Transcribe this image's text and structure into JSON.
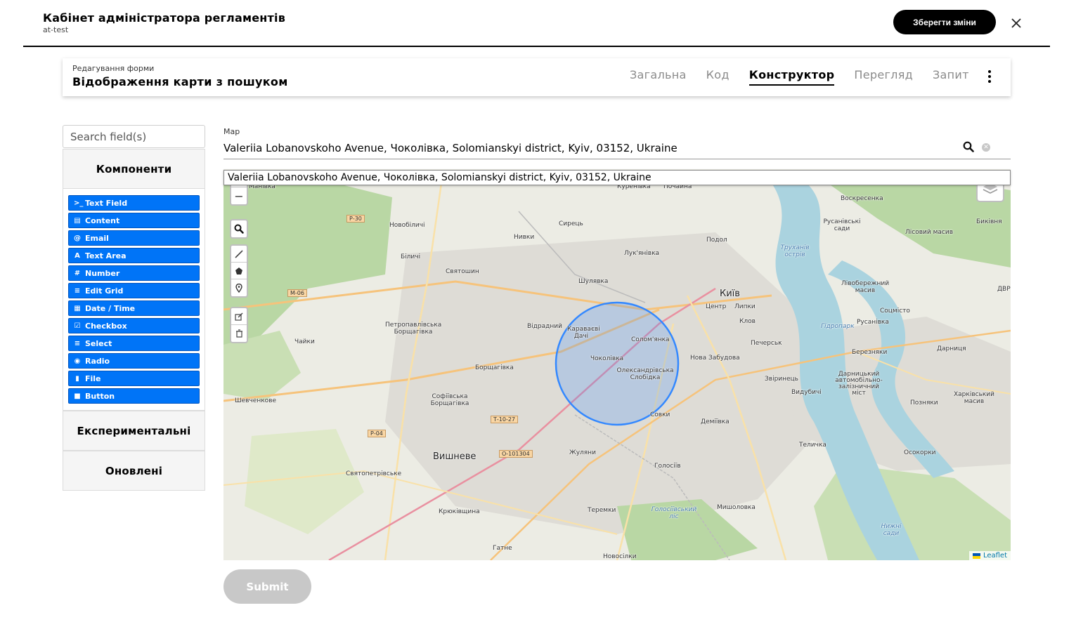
{
  "header": {
    "title": "Кабінет адміністратора регламентів",
    "subtitle": "at-test",
    "save_label": "Зберегти зміни"
  },
  "form": {
    "caption": "Редагування форми",
    "name": "Відображення карти з пошуком",
    "tabs": [
      {
        "label": "Загальна",
        "active": false
      },
      {
        "label": "Код",
        "active": false
      },
      {
        "label": "Конструктор",
        "active": true
      },
      {
        "label": "Перегляд",
        "active": false
      },
      {
        "label": "Запит",
        "active": false
      }
    ]
  },
  "sidebar": {
    "search_placeholder": "Search field(s)",
    "groups": {
      "components": "Компоненти",
      "experimental": "Експериментальні",
      "updated": "Оновлені"
    },
    "components": [
      {
        "label": "Text Field",
        "icon": "terminal-icon",
        "glyph": ">_"
      },
      {
        "label": "Content",
        "icon": "document-icon",
        "glyph": "▤"
      },
      {
        "label": "Email",
        "icon": "at-icon",
        "glyph": "@"
      },
      {
        "label": "Text Area",
        "icon": "font-icon",
        "glyph": "A"
      },
      {
        "label": "Number",
        "icon": "hash-icon",
        "glyph": "#"
      },
      {
        "label": "Edit Grid",
        "icon": "list-icon",
        "glyph": "≡"
      },
      {
        "label": "Date / Time",
        "icon": "calendar-icon",
        "glyph": "▦"
      },
      {
        "label": "Checkbox",
        "icon": "checkbox-icon",
        "glyph": "☑"
      },
      {
        "label": "Select",
        "icon": "list-icon",
        "glyph": "≡"
      },
      {
        "label": "Radio",
        "icon": "radio-icon",
        "glyph": "◉"
      },
      {
        "label": "File",
        "icon": "file-icon",
        "glyph": "▮"
      },
      {
        "label": "Button",
        "icon": "stop-icon",
        "glyph": "■"
      }
    ]
  },
  "map_field": {
    "label": "Map",
    "value": "Valeriia Lobanovskoho Avenue, Чоколівка, Solomianskyi district, Kyiv, 03152, Ukraine",
    "suggestion": "Valeriia Lobanovskoho Avenue, Чоколівка, Solomianskyi district, Kyiv, 03152, Ukraine",
    "attribution": "Leaflet"
  },
  "map_places": [
    {
      "name": "Київ",
      "big": true
    },
    {
      "name": "Вишневе",
      "big": true
    },
    {
      "name": "Воскресенка"
    },
    {
      "name": "Русанівські сади"
    },
    {
      "name": "Лісовий масив"
    },
    {
      "name": "Биківня"
    },
    {
      "name": "Подол"
    },
    {
      "name": "Труханів острів",
      "water": true
    },
    {
      "name": "Лук'янівка"
    },
    {
      "name": "Сирець"
    },
    {
      "name": "Нивки"
    },
    {
      "name": "Новобіличі"
    },
    {
      "name": "Біличі"
    },
    {
      "name": "Святошин"
    },
    {
      "name": "Шулявка"
    },
    {
      "name": "Лівобережний масив"
    },
    {
      "name": "Центр"
    },
    {
      "name": "Липки"
    },
    {
      "name": "Соцмісто"
    },
    {
      "name": "Відрадний"
    },
    {
      "name": "Караваєві Дачі"
    },
    {
      "name": "Солом'янка"
    },
    {
      "name": "Петропавлівська Борщагівка"
    },
    {
      "name": "Чайки"
    },
    {
      "name": "Клов"
    },
    {
      "name": "Печерськ"
    },
    {
      "name": "Гідропарк",
      "water": true
    },
    {
      "name": "Русанівка"
    },
    {
      "name": "Березняки"
    },
    {
      "name": "Дарниця"
    },
    {
      "name": "Чоколівка"
    },
    {
      "name": "Олександрівська Слобідка"
    },
    {
      "name": "Нова Забудова"
    },
    {
      "name": "Борщагівка"
    },
    {
      "name": "Звіринець"
    },
    {
      "name": "Видубичі"
    },
    {
      "name": "Дарницький автомобільно-залізничний міст"
    },
    {
      "name": "Харківський масив"
    },
    {
      "name": "Позняки"
    },
    {
      "name": "Шевченкове"
    },
    {
      "name": "Софіївська Борщагівка"
    },
    {
      "name": "Совки"
    },
    {
      "name": "Деміївка"
    },
    {
      "name": "Теличка"
    },
    {
      "name": "Осокорки"
    },
    {
      "name": "Жуляни"
    },
    {
      "name": "Голосіїв"
    },
    {
      "name": "Святопетрівське"
    },
    {
      "name": "Голосіївський ліс",
      "water": true
    },
    {
      "name": "Мишоловка"
    },
    {
      "name": "Теремки"
    },
    {
      "name": "Крюківщина"
    },
    {
      "name": "Нижні сади",
      "water": true
    },
    {
      "name": "Гатне"
    },
    {
      "name": "Новосілки"
    },
    {
      "name": "Манівка"
    },
    {
      "name": "Куренівка"
    },
    {
      "name": "Почайна"
    },
    {
      "name": "ДВР"
    }
  ],
  "map_roads": [
    "Р-30",
    "М-06",
    "Т-10-27",
    "Р-04",
    "О-101304"
  ],
  "submit_label": "Submit",
  "colors": {
    "accent_blue": "#0074f7",
    "circle_stroke": "#3388ff",
    "primary_button": "#000000",
    "disabled_button": "#c8c8c8"
  }
}
